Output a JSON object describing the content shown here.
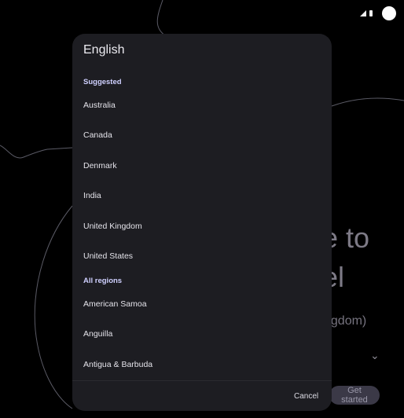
{
  "background": {
    "title_line1": "e to",
    "title_line2": "el",
    "subtitle": "ngdom)",
    "get_started_label": "Get started"
  },
  "dialog": {
    "title": "English",
    "suggested_header": "Suggested",
    "suggested": [
      "Australia",
      "Canada",
      "Denmark",
      "India",
      "United Kingdom",
      "United States"
    ],
    "all_regions_header": "All regions",
    "regions": [
      "American Samoa",
      "Anguilla",
      "Antigua & Barbuda"
    ],
    "cancel_label": "Cancel"
  },
  "colors": {
    "dialog_bg": "#1d1d22",
    "section_header": "#cfd0ff",
    "button_bg": "#3b3947"
  }
}
